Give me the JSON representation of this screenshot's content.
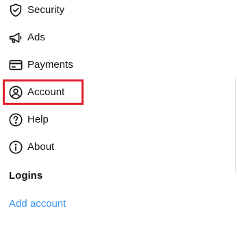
{
  "menu": {
    "items": [
      {
        "label": "Security",
        "icon": "shield-check-icon"
      },
      {
        "label": "Ads",
        "icon": "megaphone-icon"
      },
      {
        "label": "Payments",
        "icon": "credit-card-icon"
      },
      {
        "label": "Account",
        "icon": "account-circle-icon",
        "highlighted": true
      },
      {
        "label": "Help",
        "icon": "help-circle-icon"
      },
      {
        "label": "About",
        "icon": "info-circle-icon"
      }
    ]
  },
  "logins": {
    "title": "Logins",
    "add_account": "Add account"
  },
  "colors": {
    "link": "#3897f0",
    "highlight": "#e01e2b"
  }
}
